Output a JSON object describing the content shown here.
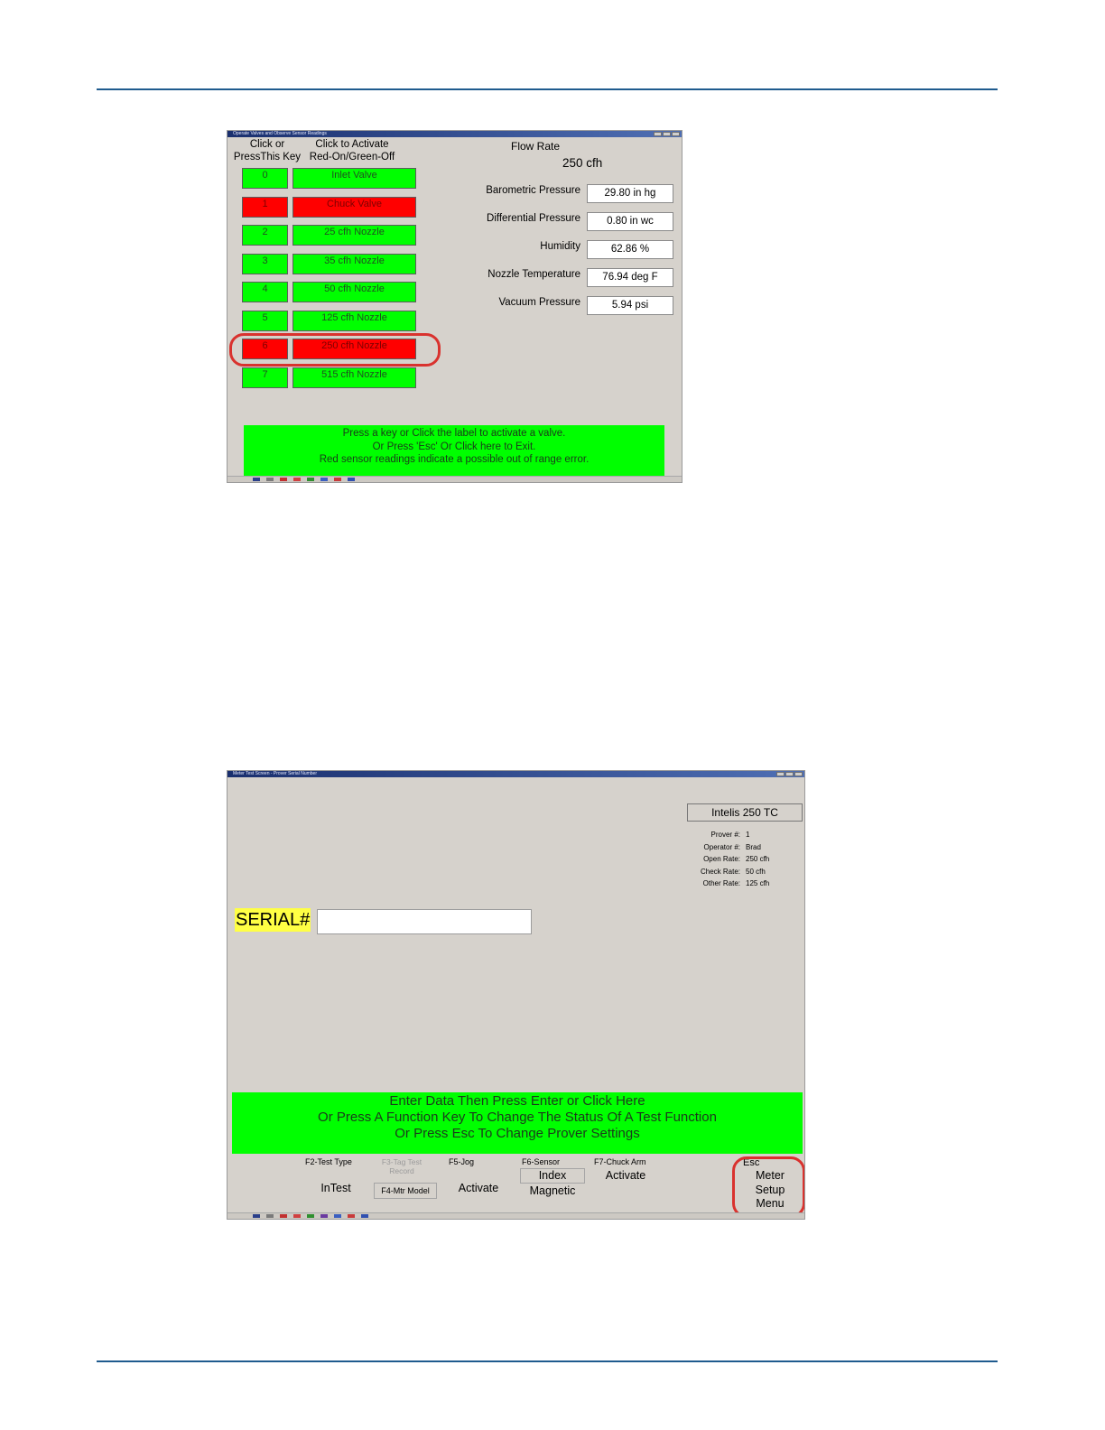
{
  "win1": {
    "title": "Operate Valves and Observe Sensor Readings",
    "col1_header": [
      "Click or",
      "PressThis Key"
    ],
    "col2_header": [
      "Click to Activate",
      "Red-On/Green-Off"
    ],
    "valves": [
      {
        "key": "0",
        "label": "Inlet Valve",
        "state": "off"
      },
      {
        "key": "1",
        "label": "Chuck Valve",
        "state": "on"
      },
      {
        "key": "2",
        "label": "25 cfh Nozzle",
        "state": "off"
      },
      {
        "key": "3",
        "label": "35 cfh Nozzle",
        "state": "off"
      },
      {
        "key": "4",
        "label": "50 cfh Nozzle",
        "state": "off"
      },
      {
        "key": "5",
        "label": "125 cfh Nozzle",
        "state": "off"
      },
      {
        "key": "6",
        "label": "250 cfh Nozzle",
        "state": "on"
      },
      {
        "key": "7",
        "label": "515 cfh Nozzle",
        "state": "off"
      }
    ],
    "flow_rate_label": "Flow Rate",
    "flow_rate_value": "250 cfh",
    "sensors": [
      {
        "label": "Barometric Pressure",
        "value": "29.80 in hg"
      },
      {
        "label": "Differential Pressure",
        "value": "0.80 in wc"
      },
      {
        "label": "Humidity",
        "value": "62.86 %"
      },
      {
        "label": "Nozzle Temperature",
        "value": "76.94 deg F"
      },
      {
        "label": "Vacuum Pressure",
        "value": "5.94 psi"
      }
    ],
    "message": [
      "Press a key or Click the label to activate a valve.",
      "Or Press 'Esc' Or Click here to Exit.",
      "Red sensor readings indicate a possible out of range error."
    ]
  },
  "win2": {
    "title": "Meter Test Screen - Prover Serial Number",
    "meter_model": "Intelis 250 TC",
    "info": [
      {
        "k": "Prover #:",
        "v": "1"
      },
      {
        "k": "Operator #:",
        "v": "Brad"
      },
      {
        "k": "Open Rate:",
        "v": "250 cfh"
      },
      {
        "k": "Check Rate:",
        "v": "50 cfh"
      },
      {
        "k": "Other Rate:",
        "v": "125 cfh"
      }
    ],
    "serial_label": "SERIAL#",
    "serial_value": "",
    "message": [
      "Enter Data Then Press Enter or Click Here",
      "Or Press A Function Key To Change The Status Of A Test Function",
      "Or Press Esc To Change Prover Settings"
    ],
    "fkeys": {
      "f2": {
        "name": "F2-Test Type",
        "value": "InTest"
      },
      "f3": {
        "name": "F3-Tag Test Record"
      },
      "f4": {
        "name": "F4-Mtr Model"
      },
      "f5": {
        "name": "F5-Jog",
        "value": "Activate"
      },
      "f6": {
        "name": "F6-Sensor",
        "value1": "Index",
        "value2": "Magnetic"
      },
      "f7": {
        "name": "F7-Chuck Arm",
        "value": "Activate"
      },
      "esc": {
        "name": "Esc",
        "lines": [
          "Meter",
          "Setup",
          "Menu"
        ]
      }
    }
  },
  "colors": {
    "rule": "#1f5b8e",
    "on": "#ff0000",
    "off": "#00ff00",
    "window_bg": "#d6d2cc",
    "highlight": "#d9322e"
  }
}
